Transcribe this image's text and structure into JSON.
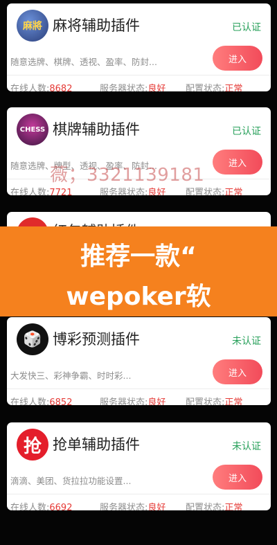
{
  "cards": [
    {
      "title": "麻将辅助插件",
      "status": "已认证",
      "desc": "随意选牌、棋牌、透视、盈率、防封...",
      "enter": "进入",
      "online_label": "在线人数:",
      "online": "8682",
      "server_label": "服务器状态:",
      "server": "良好",
      "config_label": "配置状态:",
      "config": "正常",
      "logo_text": "麻將",
      "status_color": "#27a05a"
    },
    {
      "title": "棋牌辅助插件",
      "status": "已认证",
      "desc": "随意选牌、牌型、透视、盈率、防封...",
      "enter": "进入",
      "online_label": "在线人数:",
      "online": "7721",
      "server_label": "服务器状态:",
      "server": "良好",
      "config_label": "配置状态:",
      "config": "正常",
      "logo_text": "CHESS",
      "status_color": "#27a05a"
    },
    {
      "title": "博彩预测插件",
      "status": "未认证",
      "desc": "大发快三、彩神争霸、时时彩...",
      "enter": "进入",
      "online_label": "在线人数:",
      "online": "6852",
      "server_label": "服务器状态:",
      "server": "良好",
      "config_label": "配置状态:",
      "config": "正常",
      "logo_text": "🎲",
      "status_color": "#27a05a"
    },
    {
      "title": "抢单辅助插件",
      "status": "未认证",
      "desc": "滴滴、美团、货拉拉功能设置...",
      "enter": "进入",
      "online_label": "在线人数:",
      "online": "6692",
      "server_label": "服务器状态:",
      "server": "良好",
      "config_label": "配置状态:",
      "config": "正常",
      "logo_text": "抢",
      "status_color": "#27a05a"
    }
  ],
  "watermark": "薇；3321139181",
  "banner": {
    "line1": "推荐一款“",
    "line2": "wepoker软"
  },
  "partial_card": {
    "title": "红包辅助插件"
  }
}
